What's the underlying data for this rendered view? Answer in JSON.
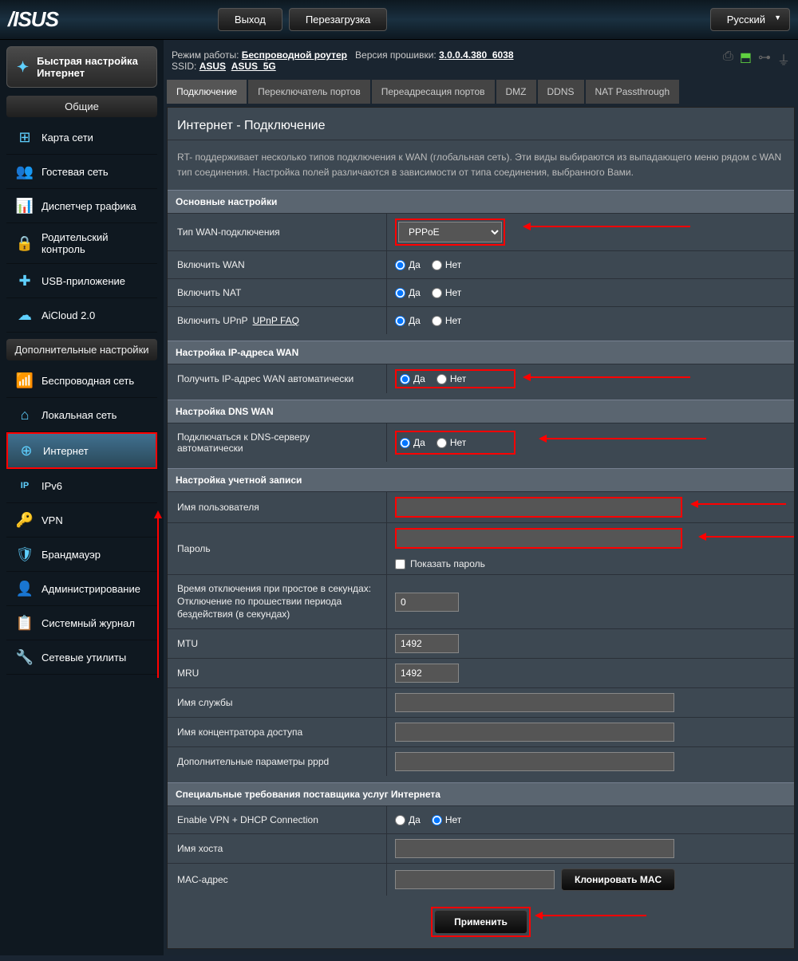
{
  "topbar": {
    "logout": "Выход",
    "reboot": "Перезагрузка",
    "language": "Русский"
  },
  "info": {
    "mode_label": "Режим работы:",
    "mode_value": "Беспроводной роутер",
    "fw_label": "Версия прошивки:",
    "fw_value": "3.0.0.4.380_6038",
    "ssid_label": "SSID:",
    "ssid_1": "ASUS",
    "ssid_2": "ASUS_5G"
  },
  "sidebar": {
    "qis": "Быстрая настройка Интернет",
    "general_title": "Общие",
    "general": [
      {
        "label": "Карта сети",
        "icon": "⊞"
      },
      {
        "label": "Гостевая сеть",
        "icon": "👥"
      },
      {
        "label": "Диспетчер трафика",
        "icon": "📊"
      },
      {
        "label": "Родительский контроль",
        "icon": "🔒"
      },
      {
        "label": "USB-приложение",
        "icon": "✚"
      },
      {
        "label": "AiCloud 2.0",
        "icon": "☁"
      }
    ],
    "advanced_title": "Дополнительные настройки",
    "advanced": [
      {
        "label": "Беспроводная сеть",
        "icon": "📶"
      },
      {
        "label": "Локальная сеть",
        "icon": "⌂"
      },
      {
        "label": "Интернет",
        "icon": "⊕"
      },
      {
        "label": "IPv6",
        "icon": "IP"
      },
      {
        "label": "VPN",
        "icon": "🔑"
      },
      {
        "label": "Брандмауэр",
        "icon": "🛡"
      },
      {
        "label": "Администрирование",
        "icon": "👤"
      },
      {
        "label": "Системный журнал",
        "icon": "📋"
      },
      {
        "label": "Сетевые утилиты",
        "icon": "🔧"
      }
    ]
  },
  "tabs": [
    "Подключение",
    "Переключатель портов",
    "Переадресация портов",
    "DMZ",
    "DDNS",
    "NAT Passthrough"
  ],
  "page": {
    "title": "Интернет - Подключение",
    "desc": "RT-           поддерживает несколько типов подключения к WAN (глобальная сеть). Эти виды выбираются из выпадающего меню рядом с WAN тип соединения. Настройка полей различаются в зависимости от типа соединения, выбранного Вами."
  },
  "sections": {
    "basic": "Основные настройки",
    "wanip": "Настройка IP-адреса WAN",
    "dns": "Настройка DNS WAN",
    "account": "Настройка учетной записи",
    "isp": "Специальные требования поставщика услуг Интернета"
  },
  "fields": {
    "wan_type": "Тип WAN-подключения",
    "wan_type_val": "PPPoE",
    "enable_wan": "Включить WAN",
    "enable_nat": "Включить NAT",
    "enable_upnp": "Включить UPnP",
    "upnp_faq": "UPnP FAQ",
    "auto_ip": "Получить IP-адрес WAN автоматически",
    "auto_dns": "Подключаться к DNS-серверу автоматически",
    "username": "Имя пользователя",
    "password": "Пароль",
    "show_pw": "Показать пароль",
    "idle": "Время отключения при простое в секундах: Отключение по прошествии периода бездействия (в секундах)",
    "idle_val": "0",
    "mtu": "MTU",
    "mtu_val": "1492",
    "mru": "MRU",
    "mru_val": "1492",
    "service": "Имя службы",
    "concentrator": "Имя концентратора доступа",
    "pppd_opts": "Дополнительные параметры pppd",
    "vpn_dhcp": "Enable VPN + DHCP Connection",
    "hostname": "Имя хоста",
    "mac": "MAC-адрес",
    "clone_mac": "Клонировать MAC"
  },
  "radio": {
    "yes": "Да",
    "no": "Нет"
  },
  "apply": "Применить"
}
